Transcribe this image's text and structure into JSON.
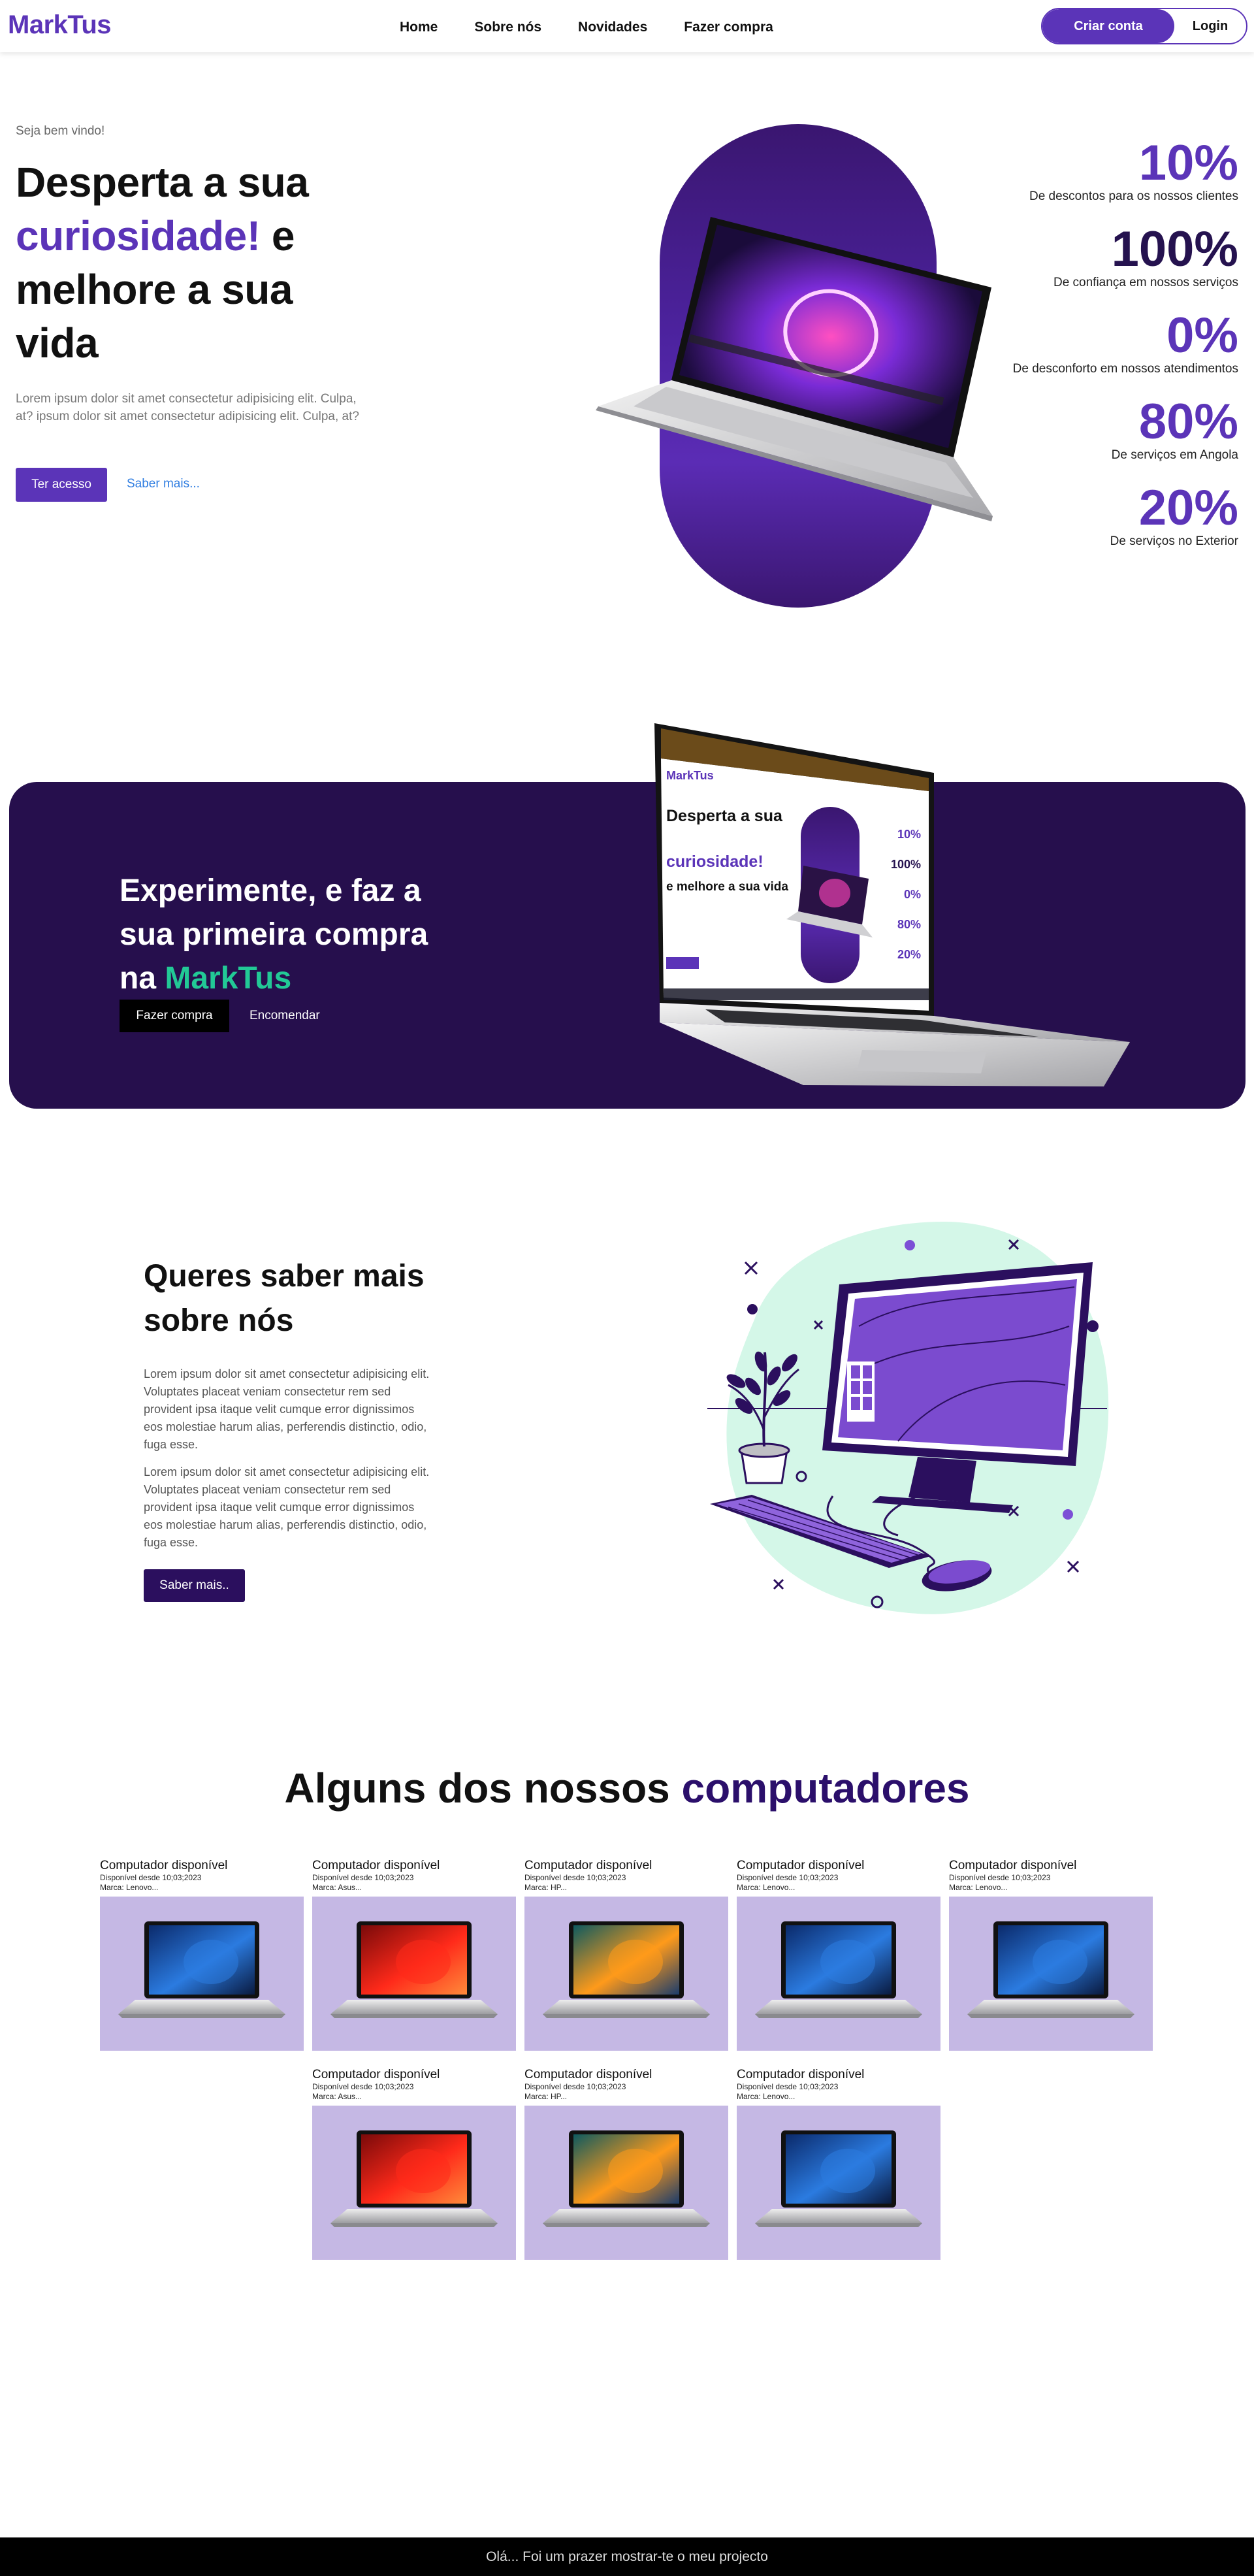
{
  "nav": {
    "logo": "MarkTus",
    "links": [
      "Home",
      "Sobre nós",
      "Novidades",
      "Fazer compra"
    ],
    "signup": "Criar conta",
    "login": "Login"
  },
  "hero": {
    "welcome": "Seja bem vindo!",
    "title_part1": "Desperta a sua",
    "title_accent": "curiosidade!",
    "title_part2": " e melhore a sua vida",
    "description": "Lorem ipsum dolor sit amet consectetur adipisicing elit. Culpa, at? ipsum dolor sit amet consectetur adipisicing elit. Culpa, at?",
    "primary_button": "Ter acesso",
    "secondary_link": "Saber mais..."
  },
  "stats": [
    {
      "value": "10%",
      "label": "De descontos para os nossos clientes"
    },
    {
      "value": "100%",
      "label": "De confiança em nossos serviços"
    },
    {
      "value": "0%",
      "label": "De desconforto em nossos atendimentos"
    },
    {
      "value": "80%",
      "label": "De serviços em Angola"
    },
    {
      "value": "20%",
      "label": "De serviços no Exterior"
    }
  ],
  "cta": {
    "title_part1": "Experimente, e faz a sua primeira compra na ",
    "title_brand": "MarkTus",
    "primary_button": "Fazer compra",
    "secondary_link": "Encomendar"
  },
  "screen_mockup": {
    "logo": "MarkTus",
    "title_part1": "Desperta a sua",
    "title_accent": "curiosidade!",
    "title_part2": " e melhore a sua vida",
    "stats": [
      "10%",
      "100%",
      "0%",
      "80%",
      "20%"
    ]
  },
  "about": {
    "title": "Queres saber mais sobre nós",
    "paragraph1": "Lorem ipsum dolor sit amet consectetur adipisicing elit. Voluptates placeat veniam consectetur rem sed provident ipsa itaque velit cumque error dignissimos eos molestiae harum alias, perferendis distinctio, odio, fuga esse.",
    "paragraph2": "Lorem ipsum dolor sit amet consectetur adipisicing elit. Voluptates placeat veniam consectetur rem sed provident ipsa itaque velit cumque error dignissimos eos molestiae harum alias, perferendis distinctio, odio, fuga esse.",
    "button": "Saber mais.."
  },
  "products": {
    "title_part1": "Alguns dos nossos ",
    "title_accent": "computadores",
    "items": [
      {
        "title": "Computador disponível",
        "since": "Disponível desde 10;03;2023",
        "brand": "Marca: Lenovo...",
        "screen": "blue"
      },
      {
        "title": "Computador disponível",
        "since": "Disponível desde 10;03;2023",
        "brand": "Marca: Asus...",
        "screen": "red"
      },
      {
        "title": "Computador disponível",
        "since": "Disponível desde 10;03;2023",
        "brand": "Marca: HP...",
        "screen": "orange"
      },
      {
        "title": "Computador disponível",
        "since": "Disponível desde 10;03;2023",
        "brand": "Marca: Lenovo...",
        "screen": "blue"
      },
      {
        "title": "Computador disponível",
        "since": "Disponível desde 10;03;2023",
        "brand": "Marca: Lenovo...",
        "screen": "blue"
      },
      {
        "title": "Computador disponível",
        "since": "Disponível desde 10;03;2023",
        "brand": "Marca: Asus...",
        "screen": "red"
      },
      {
        "title": "Computador disponível",
        "since": "Disponível desde 10;03;2023",
        "brand": "Marca: HP...",
        "screen": "orange"
      },
      {
        "title": "Computador disponível",
        "since": "Disponível desde 10;03;2023",
        "brand": "Marca: Lenovo...",
        "screen": "blue"
      }
    ]
  },
  "footer": {
    "text": "Olá... Foi um prazer mostrar-te o meu projecto"
  },
  "colors": {
    "brand": "#5b34b8",
    "dark_purple": "#260f4d",
    "accent_green": "#22c996",
    "card_bg": "#c5b8e4",
    "mint": "#d4f7e8"
  }
}
